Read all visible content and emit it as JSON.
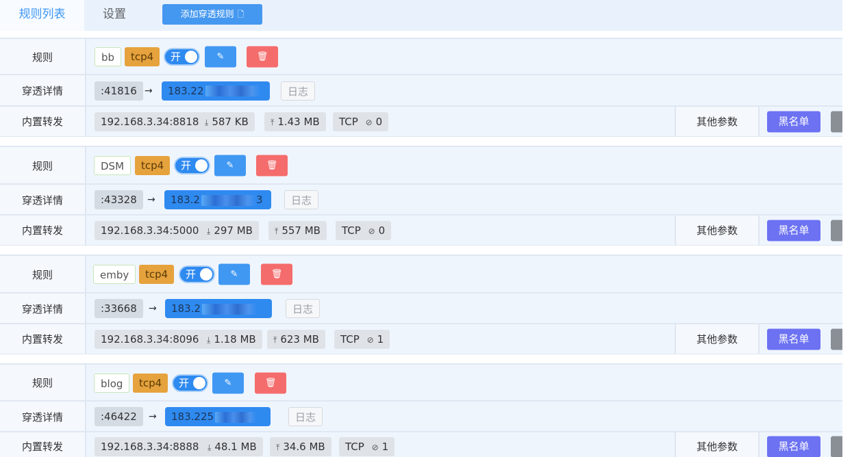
{
  "tabs": {
    "list": "规则列表",
    "settings": "设置"
  },
  "add_button": {
    "label": "添加穿透规则",
    "icon": "file-add-icon"
  },
  "labels": {
    "rule": "规则",
    "detail": "穿透详情",
    "forward": "内置转发",
    "toggle_on": "开",
    "log": "日志",
    "other_params": "其他参数",
    "blacklist": "黑名单",
    "arrow": "→",
    "edit_icon": "✎",
    "delete_icon": "🗑",
    "download_icon": "⤓",
    "upload_icon": "⤒",
    "conn_icon": "⊘"
  },
  "rules": [
    {
      "name": "bb",
      "protocol": "tcp4",
      "enabled": true,
      "remote_port": ":41816",
      "target_visible": "183.22",
      "local": "192.168.3.34:8818",
      "download": "587 KB",
      "upload": "1.43 MB",
      "transport": "TCP",
      "connections": "0"
    },
    {
      "name": "DSM",
      "protocol": "tcp4",
      "enabled": true,
      "remote_port": ":43328",
      "target_visible": "183.2",
      "target_tail": "3",
      "local": "192.168.3.34:5000",
      "download": "297 MB",
      "upload": "557 MB",
      "transport": "TCP",
      "connections": "0"
    },
    {
      "name": "emby",
      "protocol": "tcp4",
      "enabled": true,
      "remote_port": ":33668",
      "target_visible": "183.2",
      "local": "192.168.3.34:8096",
      "download": "1.18 MB",
      "upload": "623 MB",
      "transport": "TCP",
      "connections": "1"
    },
    {
      "name": "blog",
      "protocol": "tcp4",
      "enabled": true,
      "remote_port": ":46422",
      "target_visible": "183.225",
      "local": "192.168.3.34:8888",
      "download": "48.1 MB",
      "upload": "34.6 MB",
      "transport": "TCP",
      "connections": "1"
    }
  ],
  "colors": {
    "primary": "#4098f2",
    "danger": "#f56c6c",
    "warning": "#e6a23c",
    "blacklist": "#6c72f2"
  }
}
